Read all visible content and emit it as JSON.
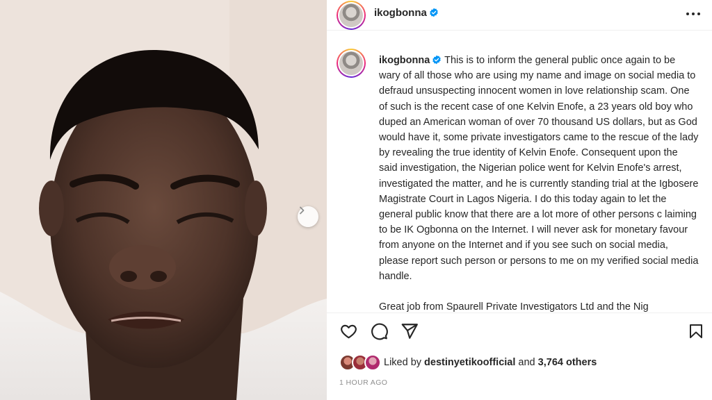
{
  "post": {
    "username": "ikogbonna",
    "timestamp": "1 HOUR AGO"
  },
  "caption": {
    "username": "ikogbonna",
    "paragraph1": "This is to inform the general public once again to be wary of all those who are using my name and image on social media to defraud unsuspecting innocent women in love relationship scam. One of such is the recent case of one Kelvin Enofe, a 23 years old boy who duped an American woman of over 70 thousand US dollars, but as God would have it, some private investigators came to the rescue of the lady by revealing the true identity of Kelvin Enofe. Consequent upon the said investigation, the Nigerian police went for Kelvin Enofe's arrest, investigated the matter, and he is currently standing trial at the Igbosere Magistrate Court in Lagos Nigeria. I do this today again to let the general public know that there are a lot more of other persons c laiming to be IK Ogbonna on the Internet. I will never ask for monetary favour from anyone on the Internet and if you see such on social media, please report such person or persons to me on my verified social media handle.",
    "paragraph2": "Great job from Spaurell Private Investigators Ltd and the Nig"
  },
  "likes": {
    "prefix": "Liked by",
    "user": "destinyetikoofficial",
    "middle": "and",
    "count": "3,764 others"
  },
  "icons": {
    "verified": "verified-badge-icon",
    "more": "more-options-icon",
    "like": "heart-icon",
    "comment": "comment-icon",
    "share": "send-icon",
    "save": "bookmark-icon",
    "next": "chevron-right-icon"
  },
  "colors": {
    "verified": "#0095f6",
    "text": "#262626",
    "muted": "#8e8e8e"
  }
}
